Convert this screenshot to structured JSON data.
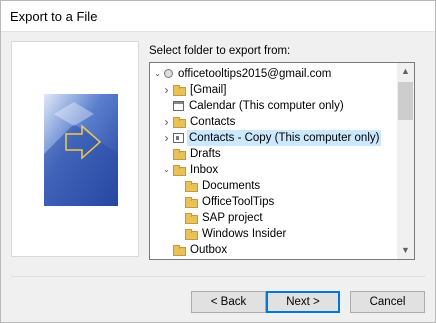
{
  "dialog": {
    "title": "Export to a File"
  },
  "prompt": "Select folder to export from:",
  "tree": {
    "items": [
      {
        "label": "officetooltips2015@gmail.com",
        "level": 0,
        "expander": "expanded",
        "icon": "account-icon"
      },
      {
        "label": "[Gmail]",
        "level": 1,
        "expander": "collapsed",
        "icon": "folder-icon"
      },
      {
        "label": "Calendar (This computer only)",
        "level": 1,
        "expander": "none",
        "icon": "calendar-icon"
      },
      {
        "label": "Contacts",
        "level": 1,
        "expander": "collapsed",
        "icon": "folder-icon"
      },
      {
        "label": "Contacts - Copy (This computer only)",
        "level": 1,
        "expander": "collapsed",
        "icon": "contacts-icon",
        "selected": true
      },
      {
        "label": "Drafts",
        "level": 1,
        "expander": "none",
        "icon": "folder-icon"
      },
      {
        "label": "Inbox",
        "level": 1,
        "expander": "expanded",
        "icon": "folder-icon"
      },
      {
        "label": "Documents",
        "level": 2,
        "expander": "none",
        "icon": "folder-icon"
      },
      {
        "label": "OfficeToolTips",
        "level": 2,
        "expander": "none",
        "icon": "folder-icon"
      },
      {
        "label": "SAP project",
        "level": 2,
        "expander": "none",
        "icon": "folder-icon"
      },
      {
        "label": "Windows Insider",
        "level": 2,
        "expander": "none",
        "icon": "folder-icon"
      },
      {
        "label": "Outbox",
        "level": 1,
        "expander": "none",
        "icon": "folder-icon"
      }
    ]
  },
  "buttons": {
    "back": "< Back",
    "next": "Next >",
    "cancel": "Cancel"
  },
  "colors": {
    "selection": "#cce8ff",
    "default_button_border": "#0078d7"
  }
}
